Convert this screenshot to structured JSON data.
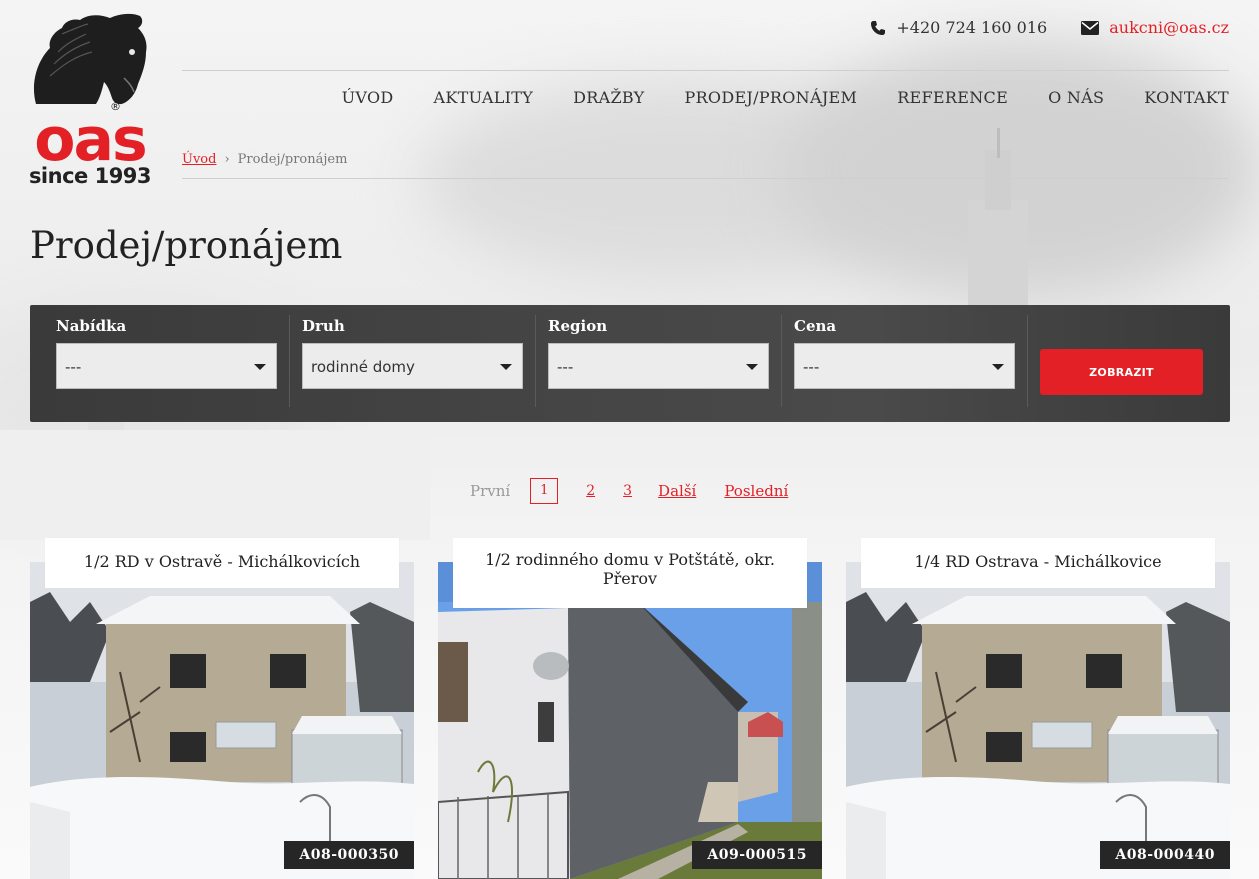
{
  "header": {
    "logo": {
      "brand": "oas",
      "registered": "®",
      "tagline": "since 1993"
    },
    "phone": "+420 724 160 016",
    "email": "aukcni@oas.cz"
  },
  "nav": {
    "items": [
      {
        "label": "ÚVOD"
      },
      {
        "label": "AKTUALITY"
      },
      {
        "label": "DRAŽBY"
      },
      {
        "label": "PRODEJ/PRONÁJEM"
      },
      {
        "label": "REFERENCE"
      },
      {
        "label": "O NÁS"
      },
      {
        "label": "KONTAKT"
      }
    ]
  },
  "breadcrumb": {
    "home": "Úvod",
    "separator": "›",
    "current": "Prodej/pronájem"
  },
  "page": {
    "title": "Prodej/pronájem"
  },
  "filter": {
    "fields": [
      {
        "label": "Nabídka",
        "value": "---"
      },
      {
        "label": "Druh",
        "value": "rodinné domy"
      },
      {
        "label": "Region",
        "value": "---"
      },
      {
        "label": "Cena",
        "value": "---"
      }
    ],
    "submit_label": "ZOBRAZIT"
  },
  "pagination": {
    "first": "První",
    "current": "1",
    "pages": [
      "2",
      "3"
    ],
    "next": "Další",
    "last": "Poslední"
  },
  "listings": [
    {
      "title": "1/2 RD v Ostravě - Michálkovicích",
      "code": "A08-000350"
    },
    {
      "title": "1/2 rodinného domu v Potštátě, okr. Přerov",
      "code": "A09-000515"
    },
    {
      "title": "1/4 RD Ostrava - Michálkovice",
      "code": "A08-000440"
    }
  ],
  "colors": {
    "accent": "#e32026",
    "filter_bg": "#424242",
    "code_bg": "#262626"
  }
}
